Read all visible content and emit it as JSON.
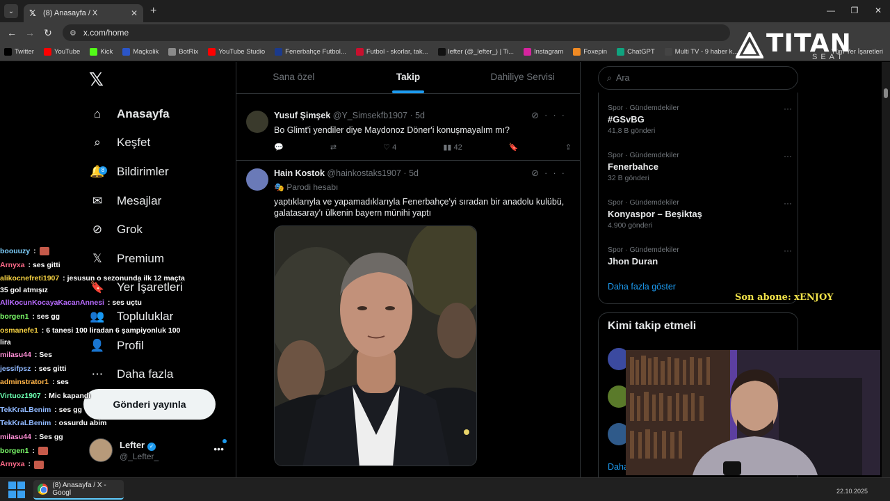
{
  "browser": {
    "tab_title": "(8) Anasayfa / X",
    "url": "x.com/home",
    "bookmarks": [
      {
        "label": "Twitter",
        "icon": "x-icon",
        "color": "#000000"
      },
      {
        "label": "YouTube",
        "icon": "youtube-icon",
        "color": "#ff0000"
      },
      {
        "label": "Kick",
        "icon": "kick-icon",
        "color": "#53fc18"
      },
      {
        "label": "Maçkolik",
        "icon": "mackolik-icon",
        "color": "#2b55c8"
      },
      {
        "label": "BotRix",
        "icon": "botrix-icon",
        "color": "#8a8a8a"
      },
      {
        "label": "YouTube Studio",
        "icon": "youtube-studio-icon",
        "color": "#ff0000"
      },
      {
        "label": "Fenerbahçe Futbol...",
        "icon": "fenerbahce-icon",
        "color": "#1b3a8c"
      },
      {
        "label": "Futbol - skorlar, tak...",
        "icon": "flashscore-icon",
        "color": "#c8102e"
      },
      {
        "label": "lefter (@_lefter_) | Ti...",
        "icon": "tiktok-icon",
        "color": "#111111"
      },
      {
        "label": "Instagram",
        "icon": "instagram-icon",
        "color": "#d6249f"
      },
      {
        "label": "Foxepin",
        "icon": "foxepin-icon",
        "color": "#f08a24"
      },
      {
        "label": "ChatGPT",
        "icon": "chatgpt-icon",
        "color": "#10a37f"
      },
      {
        "label": "Multi TV - 9 haber k...",
        "icon": "multitv-icon",
        "color": "#444444"
      }
    ],
    "bookmarks_right": "Tüm Yer İşaretleri"
  },
  "x_nav": {
    "items": [
      {
        "label": "Anasayfa",
        "icon": "home-icon",
        "active": true
      },
      {
        "label": "Keşfet",
        "icon": "search-icon"
      },
      {
        "label": "Bildirimler",
        "icon": "bell-icon",
        "badge": "8"
      },
      {
        "label": "Mesajlar",
        "icon": "mail-icon"
      },
      {
        "label": "Grok",
        "icon": "grok-icon"
      },
      {
        "label": "Premium",
        "icon": "x-icon"
      },
      {
        "label": "Yer İşaretleri",
        "icon": "bookmark-icon"
      },
      {
        "label": "Topluluklar",
        "icon": "communities-icon"
      },
      {
        "label": "Profil",
        "icon": "profile-icon"
      },
      {
        "label": "Daha fazla",
        "icon": "more-circle-icon"
      }
    ],
    "post_button": "Gönderi yayınla",
    "account": {
      "name": "Lefter",
      "handle": "@_Lefter_"
    }
  },
  "feed": {
    "tabs": [
      {
        "label": "Sana özel",
        "active": false
      },
      {
        "label": "Takip",
        "active": true
      },
      {
        "label": "Dahiliye Servisi",
        "active": false
      }
    ],
    "tweets": [
      {
        "name": "Yusuf Şimşek",
        "handle": "@Y_Simsekfb1907",
        "time": "5d",
        "text": "Bo Glimt'i yendiler diye Maydonoz Döner'i konuşmayalım mı?",
        "likes": "4",
        "views": "42"
      },
      {
        "name": "Hain Kostok",
        "handle": "@hainkostaks1907",
        "time": "5d",
        "parody": "Parodi hesabı",
        "text": "yaptıklarıyla ve yapamadıklarıyla Fenerbahçe'yi sıradan bir anadolu kulübü, galatasaray'ı ülkenin bayern münihi yaptı"
      }
    ]
  },
  "sidebar": {
    "search_placeholder": "Ara",
    "trends": [
      {
        "context": "Spor · Gündemdekiler",
        "title": "#GSvBG",
        "count": "41,8 B gönderi"
      },
      {
        "context": "Spor · Gündemdekiler",
        "title": "Fenerbahce",
        "count": "32 B gönderi"
      },
      {
        "context": "Spor · Gündemdekiler",
        "title": "Konyaspor – Beşiktaş",
        "count": "4.900 gönderi"
      },
      {
        "context": "Spor · Gündemdekiler",
        "title": "Jhon Duran",
        "count": ""
      }
    ],
    "show_more": "Daha fazla göster",
    "who_to_follow_title": "Kimi takip etmeli",
    "who_to_follow_more": "Daha"
  },
  "overlay": {
    "brand": "TITAN",
    "brand_sub": "SEAT",
    "last_subscriber": "Son abone: xENJOY",
    "chat": [
      {
        "user": "boouuzy",
        "msg": "",
        "color": "#7fd1ff",
        "emote": true
      },
      {
        "user": "Arnyxa",
        "msg": "ses gitti",
        "color": "#ff6b8a"
      },
      {
        "user": "alikocnefreti1907",
        "msg": "jesusun o sezonunda ilk 12 maçta 35 gol atmışız",
        "color": "#f5d142",
        "wrap": true
      },
      {
        "user": "AllKocunKocayaKacanAnnesi",
        "msg": "ses uçtu",
        "color": "#b86bff"
      },
      {
        "user": "borgen1",
        "msg": "ses gg",
        "color": "#7dff6b"
      },
      {
        "user": "osmanefe1",
        "msg": "6 tanesi 100 liradan 6 şampiyonluk 100 lira",
        "color": "#f5d142",
        "wrap": true
      },
      {
        "user": "milasu44",
        "msg": "Ses",
        "color": "#ff8fd6"
      },
      {
        "user": "jessifpsz",
        "msg": "ses gitti",
        "color": "#8fb8ff"
      },
      {
        "user": "adminstrator1",
        "msg": "ses",
        "color": "#ffb347"
      },
      {
        "user": "Virtuoz1907",
        "msg": "Mic kapandı",
        "color": "#6bffb0"
      },
      {
        "user": "TekKraLBenim",
        "msg": "ses gg",
        "color": "#8fb8ff"
      },
      {
        "user": "TekKraLBenim",
        "msg": "ossurdu abim",
        "color": "#8fb8ff"
      },
      {
        "user": "milasu44",
        "msg": "Ses gg",
        "color": "#ff8fd6"
      },
      {
        "user": "borgen1",
        "msg": "",
        "color": "#7dff6b",
        "emote": true
      },
      {
        "user": "Arnyxa",
        "msg": "",
        "color": "#ff6b8a",
        "emote": true
      }
    ]
  },
  "taskbar": {
    "app_label": "(8) Anasayfa / X - Googl",
    "clock": "22.10.2025"
  }
}
